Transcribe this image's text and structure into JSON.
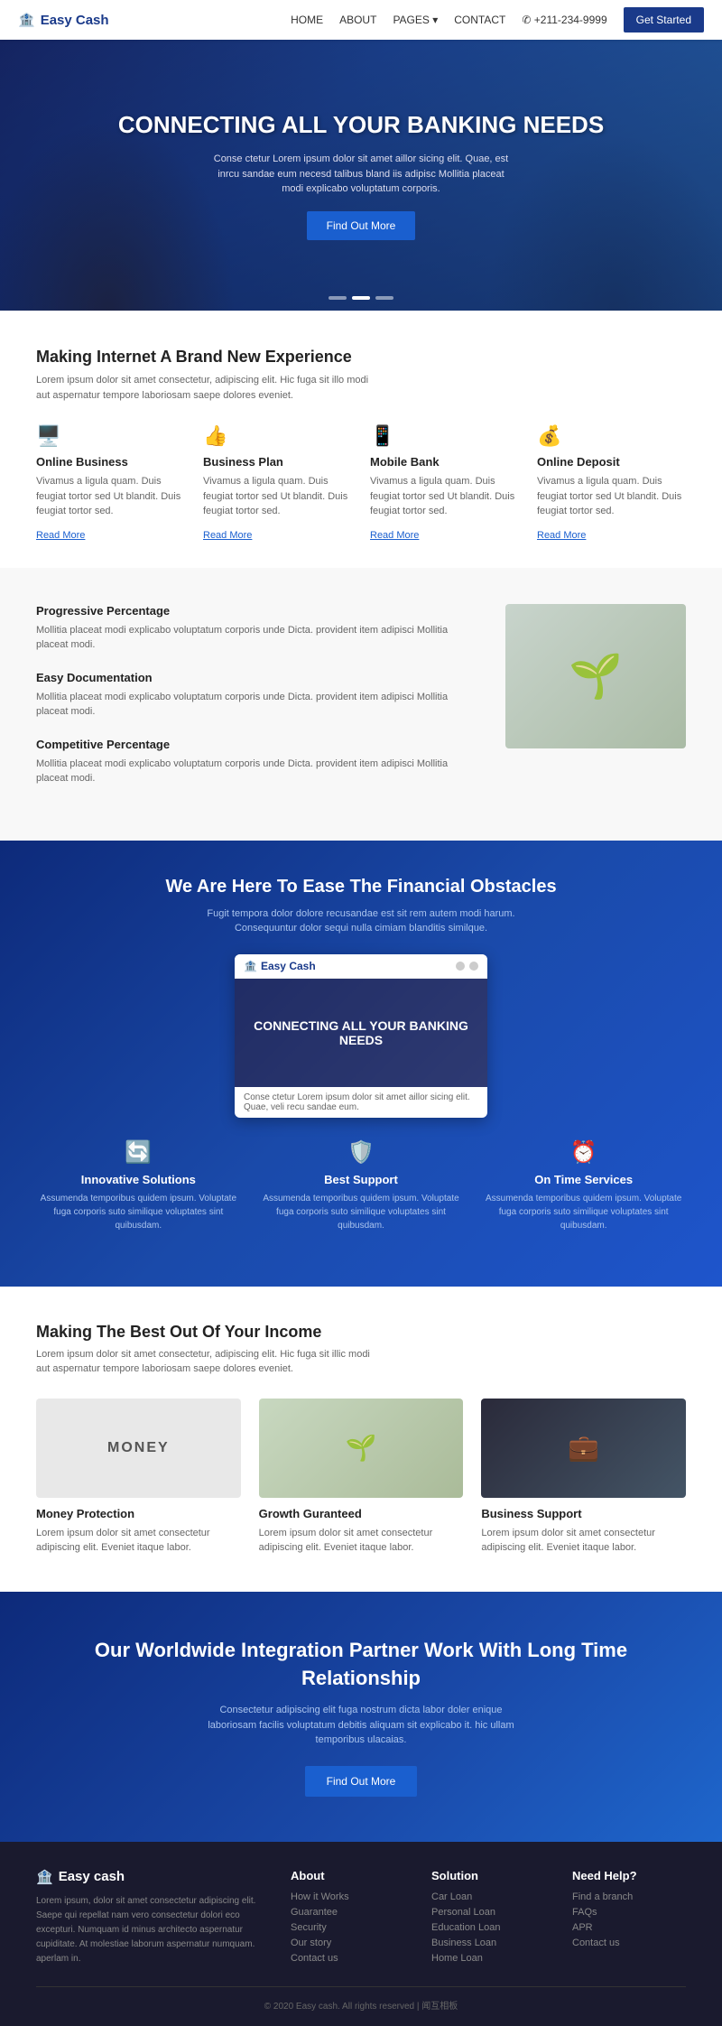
{
  "nav": {
    "logo": "Easy Cash",
    "links": [
      "HOME",
      "ABOUT",
      "PAGES ▾",
      "CONTACT"
    ],
    "phone": "✆ +211-234-9999",
    "cta": "Get Started"
  },
  "hero": {
    "heading": "CONNECTING ALL YOUR BANKING NEEDS",
    "desc": "Conse ctetur Lorem ipsum dolor sit amet aillor sicing elit. Quae, est inrcu sandae eum necesd talibus bland iis adipisc Mollitia placeat modi explicabo voluptatum corporis.",
    "btn": "Find Out More",
    "dots": 3,
    "active_dot": 1
  },
  "features_section": {
    "heading": "Making Internet A Brand New Experience",
    "sub": "Lorem ipsum dolor sit amet consectetur, adipiscing elit. Hic fuga sit illo modi aut aspernatur tempore laboriosam saepe dolores eveniet.",
    "items": [
      {
        "icon": "🖥️",
        "title": "Online Business",
        "desc": "Vivamus a ligula quam. Duis feugiat tortor sed Ut blandit. Duis feugiat tortor sed.",
        "read_more": "Read More"
      },
      {
        "icon": "👍",
        "title": "Business Plan",
        "desc": "Vivamus a ligula quam. Duis feugiat tortor sed Ut blandit. Duis feugiat tortor sed.",
        "read_more": "Read More"
      },
      {
        "icon": "📱",
        "title": "Mobile Bank",
        "desc": "Vivamus a ligula quam. Duis feugiat tortor sed Ut blandit. Duis feugiat tortor sed.",
        "read_more": "Read More"
      },
      {
        "icon": "💰",
        "title": "Online Deposit",
        "desc": "Vivamus a ligula quam. Duis feugiat tortor sed Ut blandit. Duis feugiat tortor sed.",
        "read_more": "Read More"
      }
    ]
  },
  "info_section": {
    "items": [
      {
        "title": "Progressive Percentage",
        "desc": "Mollitia placeat modi explicabo voluptatum corporis unde Dicta. provident item adipisci Mollitia placeat modi."
      },
      {
        "title": "Easy Documentation",
        "desc": "Mollitia placeat modi explicabo voluptatum corporis unde Dicta. provident item adipisci Mollitia placeat modi."
      },
      {
        "title": "Competitive Percentage",
        "desc": "Mollitia placeat modi explicabo voluptatum corporis unde Dicta. provident item adipisci Mollitia placeat modi."
      }
    ],
    "img_icon": "🌱"
  },
  "blue_section": {
    "heading": "We Are Here To Ease The Financial Obstacles",
    "desc": "Fugit tempora dolor dolore recusandae est sit rem autem modi harum. Consequuntur dolor sequi nulla cimiam blanditis similque.",
    "video_logo": "Easy Cash",
    "video_heading": "CONNECTING ALL YOUR BANKING NEEDS",
    "video_caption": "Conse ctetur Lorem ipsum dolor sit amet aillor sicing elit. Quae, veli recu sandae eum.",
    "features": [
      {
        "icon": "🔄",
        "title": "Innovative Solutions",
        "desc": "Assumenda temporibus quidem ipsum. Voluptate fuga corporis suto similique voluptates sint quibusdam."
      },
      {
        "icon": "🛡️",
        "title": "Best Support",
        "desc": "Assumenda temporibus quidem ipsum. Voluptate fuga corporis suto similique voluptates sint quibusdam."
      },
      {
        "icon": "⏰",
        "title": "On Time Services",
        "desc": "Assumenda temporibus quidem ipsum. Voluptate fuga corporis suto similique voluptates sint quibusdam."
      }
    ]
  },
  "income_section": {
    "heading": "Making The Best Out Of Your Income",
    "sub": "Lorem ipsum dolor sit amet consectetur, adipiscing elit. Hic fuga sit illic modi aut aspernatur tempore laboriosam saepe dolores eveniet.",
    "cards": [
      {
        "type": "money",
        "icon": "MONEY",
        "title": "Money Protection",
        "desc": "Lorem ipsum dolor sit amet consectetur adipiscing elit. Eveniet itaque labor."
      },
      {
        "type": "plant",
        "icon": "🌱",
        "title": "Growth Guranteed",
        "desc": "Lorem ipsum dolor sit amet consectetur adipiscing elit. Eveniet itaque labor."
      },
      {
        "type": "business",
        "icon": "💼",
        "title": "Business Support",
        "desc": "Lorem ipsum dolor sit amet consectetur adipiscing elit. Eveniet itaque labor."
      }
    ]
  },
  "cta_section": {
    "heading": "Our Worldwide Integration Partner Work With Long Time Relationship",
    "desc": "Consectetur adipiscing elit fuga nostrum dicta labor doler enique laboriosam facilis voluptatum debitis aliquam sit explicabo it. hic ullam temporibus ulacaias.",
    "btn": "Find Out More"
  },
  "footer": {
    "brand_logo": "Easy cash",
    "brand_desc": "Lorem ipsum, dolor sit amet consectetur adipiscing elit. Saepe qui repellat nam vero consectetur dolori eco excepturi. Numquam id minus architecto aspernatur cupiditate. At molestiae laborum aspernatur numquam. aperlam in.",
    "about_title": "About",
    "about_links": [
      "How it Works",
      "Guarantee",
      "Security",
      "Our story",
      "Contact us"
    ],
    "solution_title": "Solution",
    "solution_links": [
      "Car Loan",
      "Personal Loan",
      "Education Loan",
      "Business Loan",
      "Home Loan"
    ],
    "help_title": "Need Help?",
    "help_links": [
      "Find a branch",
      "FAQs",
      "APR",
      "Contact us"
    ],
    "copyright": "© 2020 Easy cash. All rights reserved | 闻互相板"
  }
}
